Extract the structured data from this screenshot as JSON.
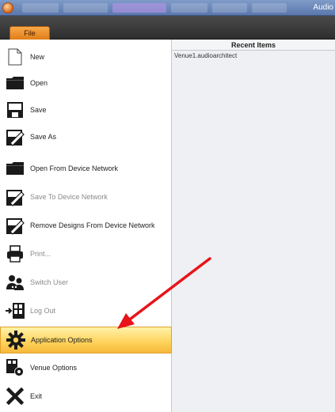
{
  "window": {
    "app_title": "Audio"
  },
  "file_tab": {
    "label": "File"
  },
  "menu": {
    "items": [
      {
        "id": "new",
        "label": "New",
        "icon": "new-document-icon",
        "disabled": false
      },
      {
        "id": "open",
        "label": "Open",
        "icon": "folder-icon",
        "disabled": false
      },
      {
        "id": "save",
        "label": "Save",
        "icon": "floppy-disk-icon",
        "disabled": false
      },
      {
        "id": "save-as",
        "label": "Save As",
        "icon": "save-as-icon",
        "disabled": false
      },
      {
        "id": "open-from-device-network",
        "label": "Open From Device Network",
        "icon": "folder-icon",
        "disabled": false
      },
      {
        "id": "save-to-device-network",
        "label": "Save To Device Network",
        "icon": "save-as-icon",
        "disabled": true
      },
      {
        "id": "remove-designs",
        "label": "Remove Designs From Device Network",
        "icon": "save-as-icon",
        "disabled": false
      },
      {
        "id": "print",
        "label": "Print...",
        "icon": "printer-icon",
        "disabled": true
      },
      {
        "id": "switch-user",
        "label": "Switch User",
        "icon": "users-icon",
        "disabled": true
      },
      {
        "id": "log-out",
        "label": "Log Out",
        "icon": "log-out-icon",
        "disabled": true
      },
      {
        "id": "application-options",
        "label": "Application Options",
        "icon": "gear-icon",
        "disabled": false,
        "active": true
      },
      {
        "id": "venue-options",
        "label": "Venue Options",
        "icon": "venue-gear-icon",
        "disabled": false
      },
      {
        "id": "exit",
        "label": "Exit",
        "icon": "close-x-icon",
        "disabled": false
      }
    ]
  },
  "recent": {
    "header": "Recent Items",
    "items": [
      "Venue1.audioarchitect"
    ]
  },
  "colors": {
    "active_highlight": "#ffd25a",
    "file_tab": "#f09a30",
    "annotation_arrow": "#e8141a"
  }
}
